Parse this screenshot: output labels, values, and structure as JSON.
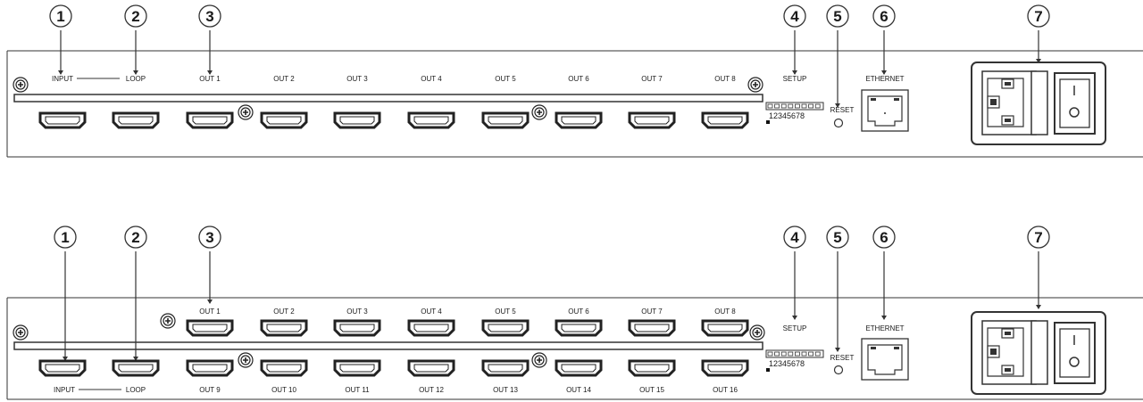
{
  "callouts": [
    "1",
    "2",
    "3",
    "4",
    "5",
    "6",
    "7"
  ],
  "panel_top": {
    "input_label": "INPUT",
    "loop_label": "LOOP",
    "out_labels": [
      "OUT 1",
      "OUT 2",
      "OUT 3",
      "OUT 4",
      "OUT 5",
      "OUT 6",
      "OUT 7",
      "OUT 8"
    ],
    "setup_label": "SETUP",
    "dip_numbers": "12345678",
    "reset_label": "RESET",
    "ethernet_label": "ETHERNET"
  },
  "panel_bottom": {
    "input_label": "INPUT",
    "loop_label": "LOOP",
    "out_labels_top": [
      "OUT 1",
      "OUT 2",
      "OUT 3",
      "OUT 4",
      "OUT 5",
      "OUT 6",
      "OUT 7",
      "OUT 8"
    ],
    "out_labels_bottom": [
      "OUT 9",
      "OUT 10",
      "OUT 11",
      "OUT 12",
      "OUT 13",
      "OUT 14",
      "OUT 15",
      "OUT 16"
    ],
    "setup_label": "SETUP",
    "dip_numbers": "12345678",
    "reset_label": "RESET",
    "ethernet_label": "ETHERNET"
  },
  "colors": {
    "line": "#333333",
    "panel_fill": "#ffffff",
    "callout_bg": "#ffffff"
  }
}
